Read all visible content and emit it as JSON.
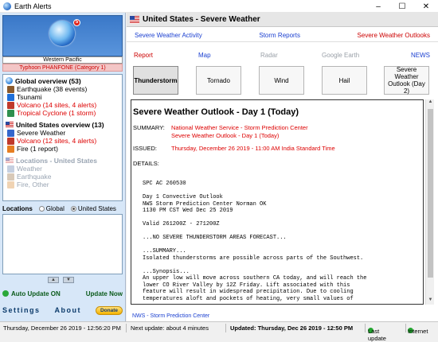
{
  "window": {
    "title": "Earth Alerts",
    "controls": {
      "minimize": "–",
      "maximize": "☐",
      "close": "✕"
    }
  },
  "left": {
    "alert_count": "5",
    "region": "Western Pacific",
    "typhoon": "Typhoon PHANFONE (Category 1)",
    "global": {
      "header": "Global overview (53)",
      "items": [
        {
          "label": "Earthquake (38 events)",
          "style": "normal",
          "icon": "earthquake-icon",
          "color": "#8b5a2b"
        },
        {
          "label": "Tsunami",
          "style": "normal",
          "icon": "tsunami-icon",
          "color": "#1e6fd9"
        },
        {
          "label": "Volcano (14 sites, 4 alerts)",
          "style": "red",
          "icon": "volcano-icon",
          "color": "#c0392b"
        },
        {
          "label": "Tropical Cyclone (1 storm)",
          "style": "red",
          "icon": "cyclone-icon",
          "color": "#2f8f4e"
        }
      ]
    },
    "us": {
      "header": "United States overview (13)",
      "items": [
        {
          "label": "Severe Weather",
          "style": "normal",
          "icon": "severe-weather-icon",
          "color": "#3366cc"
        },
        {
          "label": "Volcano (12 sites, 4 alerts)",
          "style": "red",
          "icon": "volcano-icon",
          "color": "#c0392b"
        },
        {
          "label": "Fire (1 report)",
          "style": "normal",
          "icon": "fire-icon",
          "color": "#e67e22"
        }
      ]
    },
    "locations_us": {
      "header": "Locations - United States",
      "items": [
        "Weather",
        "Earthquake",
        "Fire, Other"
      ]
    },
    "locations_label": "Locations",
    "radio_global": "Global",
    "radio_us": "United States",
    "auto_update": "Auto Update ON",
    "update_now": "Update Now",
    "settings": "Settings",
    "about": "About",
    "donate": "Donate"
  },
  "right": {
    "header": "United States - Severe Weather",
    "tabs": [
      "Severe Weather Activity",
      "Storm Reports",
      "Severe Weather Outlooks"
    ],
    "subtabs": {
      "report": "Report",
      "map": "Map",
      "radar": "Radar",
      "google_earth": "Google Earth",
      "news": "NEWS"
    },
    "buttons": [
      "Thunderstorm",
      "Tornado",
      "Wind",
      "Hail",
      "Severe Weather Outlook (Day 2)"
    ],
    "content": {
      "title": "Severe Weather Outlook - Day 1 (Today)",
      "summary_label": "SUMMARY:",
      "summary_line1": "National Weather Service - Storm Prediction Center",
      "summary_line2": "Severe Weather Outlook - Day 1 (Today)",
      "issued_label": "ISSUED:",
      "issued_value": "Thursday, December 26 2019 - 11:00 AM India Standard Time",
      "details_label": "DETAILS:",
      "details": "SPC AC 260530\n\nDay 1 Convective Outlook\nNWS Storm Prediction Center Norman OK\n1130 PM CST Wed Dec 25 2019\n\nValid 261200Z - 271200Z\n\n...NO SEVERE THUNDERSTORM AREAS FORECAST...\n\n...SUMMARY...\nIsolated thunderstorms are possible across parts of the Southwest.\n\n...Synopsis...\nAn upper low will move across southern CA today, and will reach the\nlower CO River Valley by 12Z Friday. Lift associated with this\nfeature will result in widespread precipitation. Due to cooling\ntemperatures aloft and pockets of heating, very small values of"
    },
    "source": "NWS - Storm Prediction Center"
  },
  "status": {
    "now": "Thursday, December 26 2019 - 12:56:20 PM",
    "next": "Next update: about 4 minutes",
    "updated": "Updated: Thursday, Dec 26 2019 - 12:50 PM",
    "last_update": "Last update",
    "internet": "Internet"
  }
}
